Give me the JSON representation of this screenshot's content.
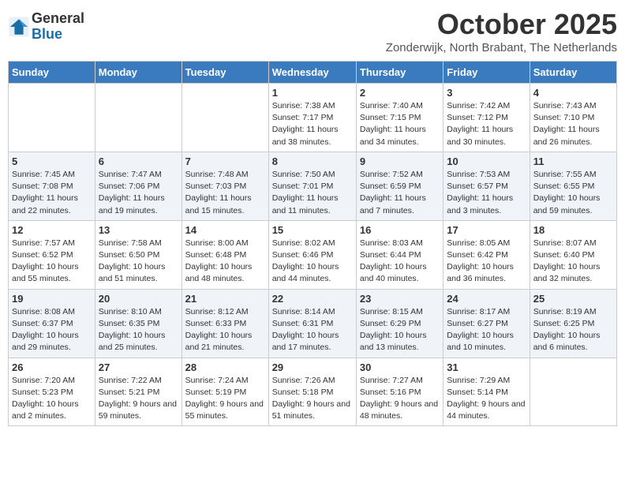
{
  "header": {
    "logo_general": "General",
    "logo_blue": "Blue",
    "month": "October 2025",
    "location": "Zonderwijk, North Brabant, The Netherlands"
  },
  "weekdays": [
    "Sunday",
    "Monday",
    "Tuesday",
    "Wednesday",
    "Thursday",
    "Friday",
    "Saturday"
  ],
  "weeks": [
    [
      {
        "day": "",
        "info": ""
      },
      {
        "day": "",
        "info": ""
      },
      {
        "day": "",
        "info": ""
      },
      {
        "day": "1",
        "info": "Sunrise: 7:38 AM\nSunset: 7:17 PM\nDaylight: 11 hours and 38 minutes."
      },
      {
        "day": "2",
        "info": "Sunrise: 7:40 AM\nSunset: 7:15 PM\nDaylight: 11 hours and 34 minutes."
      },
      {
        "day": "3",
        "info": "Sunrise: 7:42 AM\nSunset: 7:12 PM\nDaylight: 11 hours and 30 minutes."
      },
      {
        "day": "4",
        "info": "Sunrise: 7:43 AM\nSunset: 7:10 PM\nDaylight: 11 hours and 26 minutes."
      }
    ],
    [
      {
        "day": "5",
        "info": "Sunrise: 7:45 AM\nSunset: 7:08 PM\nDaylight: 11 hours and 22 minutes."
      },
      {
        "day": "6",
        "info": "Sunrise: 7:47 AM\nSunset: 7:06 PM\nDaylight: 11 hours and 19 minutes."
      },
      {
        "day": "7",
        "info": "Sunrise: 7:48 AM\nSunset: 7:03 PM\nDaylight: 11 hours and 15 minutes."
      },
      {
        "day": "8",
        "info": "Sunrise: 7:50 AM\nSunset: 7:01 PM\nDaylight: 11 hours and 11 minutes."
      },
      {
        "day": "9",
        "info": "Sunrise: 7:52 AM\nSunset: 6:59 PM\nDaylight: 11 hours and 7 minutes."
      },
      {
        "day": "10",
        "info": "Sunrise: 7:53 AM\nSunset: 6:57 PM\nDaylight: 11 hours and 3 minutes."
      },
      {
        "day": "11",
        "info": "Sunrise: 7:55 AM\nSunset: 6:55 PM\nDaylight: 10 hours and 59 minutes."
      }
    ],
    [
      {
        "day": "12",
        "info": "Sunrise: 7:57 AM\nSunset: 6:52 PM\nDaylight: 10 hours and 55 minutes."
      },
      {
        "day": "13",
        "info": "Sunrise: 7:58 AM\nSunset: 6:50 PM\nDaylight: 10 hours and 51 minutes."
      },
      {
        "day": "14",
        "info": "Sunrise: 8:00 AM\nSunset: 6:48 PM\nDaylight: 10 hours and 48 minutes."
      },
      {
        "day": "15",
        "info": "Sunrise: 8:02 AM\nSunset: 6:46 PM\nDaylight: 10 hours and 44 minutes."
      },
      {
        "day": "16",
        "info": "Sunrise: 8:03 AM\nSunset: 6:44 PM\nDaylight: 10 hours and 40 minutes."
      },
      {
        "day": "17",
        "info": "Sunrise: 8:05 AM\nSunset: 6:42 PM\nDaylight: 10 hours and 36 minutes."
      },
      {
        "day": "18",
        "info": "Sunrise: 8:07 AM\nSunset: 6:40 PM\nDaylight: 10 hours and 32 minutes."
      }
    ],
    [
      {
        "day": "19",
        "info": "Sunrise: 8:08 AM\nSunset: 6:37 PM\nDaylight: 10 hours and 29 minutes."
      },
      {
        "day": "20",
        "info": "Sunrise: 8:10 AM\nSunset: 6:35 PM\nDaylight: 10 hours and 25 minutes."
      },
      {
        "day": "21",
        "info": "Sunrise: 8:12 AM\nSunset: 6:33 PM\nDaylight: 10 hours and 21 minutes."
      },
      {
        "day": "22",
        "info": "Sunrise: 8:14 AM\nSunset: 6:31 PM\nDaylight: 10 hours and 17 minutes."
      },
      {
        "day": "23",
        "info": "Sunrise: 8:15 AM\nSunset: 6:29 PM\nDaylight: 10 hours and 13 minutes."
      },
      {
        "day": "24",
        "info": "Sunrise: 8:17 AM\nSunset: 6:27 PM\nDaylight: 10 hours and 10 minutes."
      },
      {
        "day": "25",
        "info": "Sunrise: 8:19 AM\nSunset: 6:25 PM\nDaylight: 10 hours and 6 minutes."
      }
    ],
    [
      {
        "day": "26",
        "info": "Sunrise: 7:20 AM\nSunset: 5:23 PM\nDaylight: 10 hours and 2 minutes."
      },
      {
        "day": "27",
        "info": "Sunrise: 7:22 AM\nSunset: 5:21 PM\nDaylight: 9 hours and 59 minutes."
      },
      {
        "day": "28",
        "info": "Sunrise: 7:24 AM\nSunset: 5:19 PM\nDaylight: 9 hours and 55 minutes."
      },
      {
        "day": "29",
        "info": "Sunrise: 7:26 AM\nSunset: 5:18 PM\nDaylight: 9 hours and 51 minutes."
      },
      {
        "day": "30",
        "info": "Sunrise: 7:27 AM\nSunset: 5:16 PM\nDaylight: 9 hours and 48 minutes."
      },
      {
        "day": "31",
        "info": "Sunrise: 7:29 AM\nSunset: 5:14 PM\nDaylight: 9 hours and 44 minutes."
      },
      {
        "day": "",
        "info": ""
      }
    ]
  ]
}
